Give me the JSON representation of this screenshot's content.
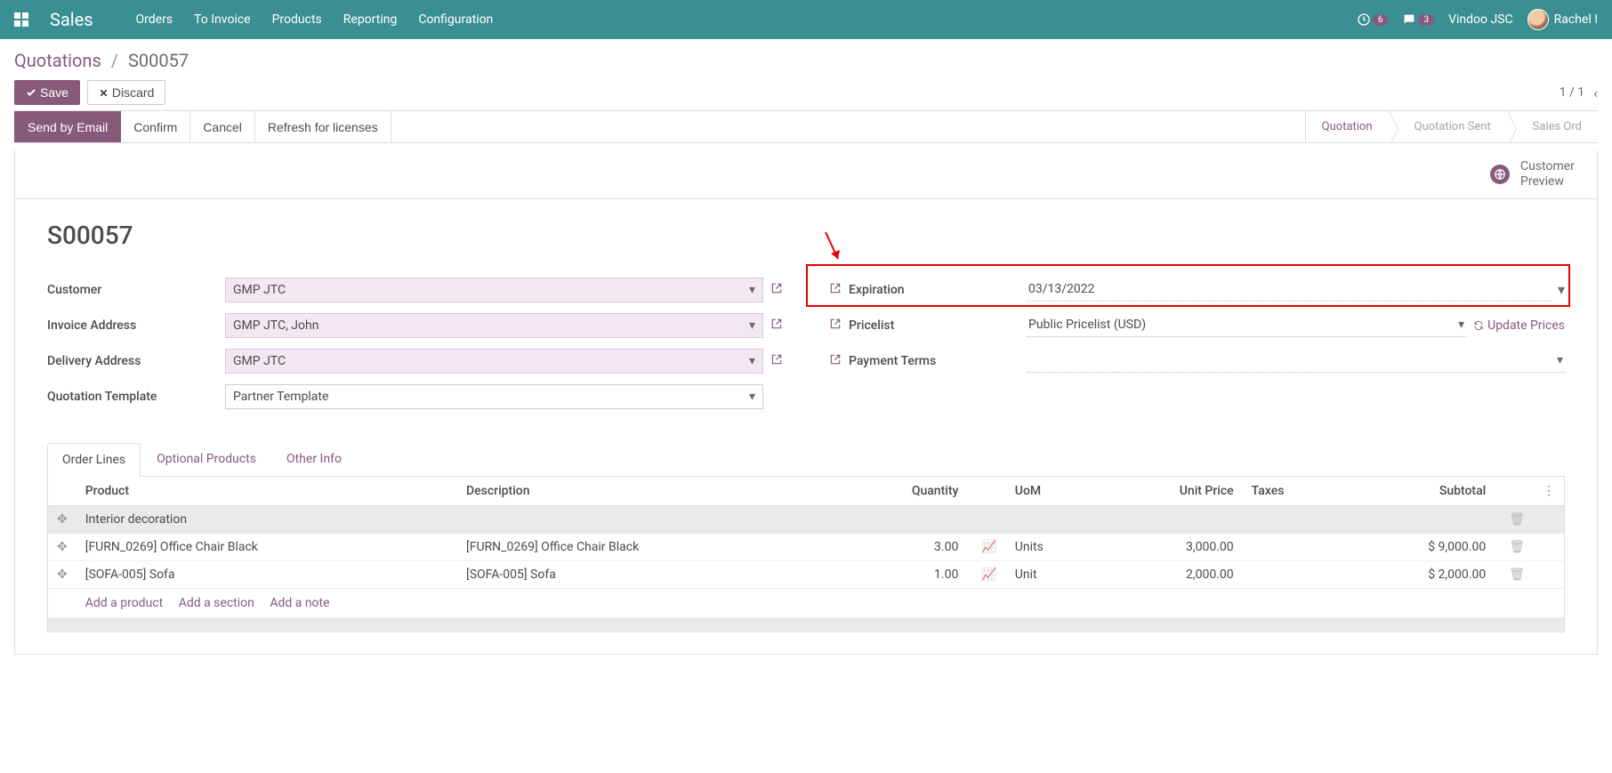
{
  "nav": {
    "brand": "Sales",
    "menu": [
      "Orders",
      "To Invoice",
      "Products",
      "Reporting",
      "Configuration"
    ],
    "activity_badge": "6",
    "chat_badge": "3",
    "company": "Vindoo JSC",
    "user": "Rachel I"
  },
  "breadcrumb": {
    "root": "Quotations",
    "current": "S00057"
  },
  "buttons": {
    "save": "Save",
    "discard": "Discard"
  },
  "pager": "1 / 1",
  "status": {
    "send": "Send by Email",
    "confirm": "Confirm",
    "cancel": "Cancel",
    "refresh": "Refresh for licenses",
    "stages": [
      "Quotation",
      "Quotation Sent",
      "Sales Ord"
    ]
  },
  "sheet": {
    "preview_label": "Customer Preview",
    "title": "S00057",
    "left": {
      "customer_label": "Customer",
      "customer_val": "GMP JTC",
      "invoice_label": "Invoice Address",
      "invoice_val": "GMP JTC, John",
      "delivery_label": "Delivery Address",
      "delivery_val": "GMP JTC",
      "template_label": "Quotation Template",
      "template_val": "Partner Template"
    },
    "right": {
      "expiration_label": "Expiration",
      "expiration_val": "03/13/2022",
      "pricelist_label": "Pricelist",
      "pricelist_val": "Public Pricelist (USD)",
      "update_prices": "Update Prices",
      "terms_label": "Payment Terms",
      "terms_val": ""
    }
  },
  "tabs": [
    "Order Lines",
    "Optional Products",
    "Other Info"
  ],
  "table": {
    "headers": {
      "product": "Product",
      "description": "Description",
      "qty": "Quantity",
      "uom": "UoM",
      "unit": "Unit Price",
      "taxes": "Taxes",
      "subtotal": "Subtotal"
    },
    "section": "Interior decoration",
    "rows": [
      {
        "product": "[FURN_0269] Office Chair Black",
        "description": "[FURN_0269] Office Chair Black",
        "qty": "3.00",
        "uom": "Units",
        "unit": "3,000.00",
        "subtotal": "$ 9,000.00"
      },
      {
        "product": "[SOFA-005] Sofa",
        "description": "[SOFA-005] Sofa",
        "qty": "1.00",
        "uom": "Unit",
        "unit": "2,000.00",
        "subtotal": "$ 2,000.00"
      }
    ],
    "actions": {
      "add_product": "Add a product",
      "add_section": "Add a section",
      "add_note": "Add a note"
    }
  }
}
